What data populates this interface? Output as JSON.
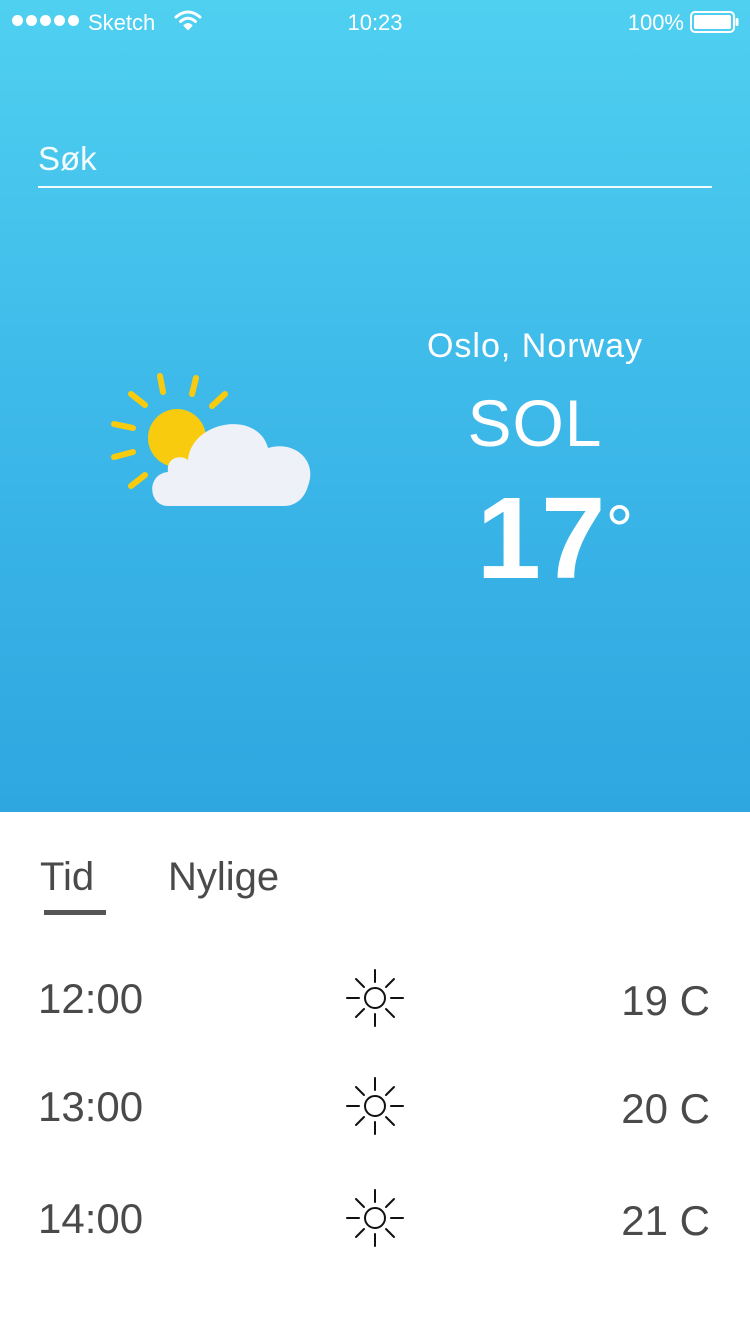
{
  "status_bar": {
    "carrier": "Sketch",
    "time": "10:23",
    "battery": "100%"
  },
  "search": {
    "placeholder": "Søk"
  },
  "current": {
    "location": "Oslo, Norway",
    "condition": "SOL",
    "temperature": "17",
    "degree_symbol": "°",
    "icon": "partly-cloudy-icon"
  },
  "tabs": [
    {
      "label": "Tid",
      "active": true
    },
    {
      "label": "Nylige",
      "active": false
    }
  ],
  "forecast": [
    {
      "time": "12:00",
      "icon": "sun-icon",
      "temp": "19 C"
    },
    {
      "time": "13:00",
      "icon": "sun-icon",
      "temp": "20 C"
    },
    {
      "time": "14:00",
      "icon": "sun-icon",
      "temp": "21 C"
    }
  ],
  "colors": {
    "hero_top": "#4fd0f0",
    "hero_bottom": "#2ea6e0",
    "sun": "#f8cb0f",
    "cloud": "#eef2f8",
    "text_dark": "#4a4a4a"
  }
}
